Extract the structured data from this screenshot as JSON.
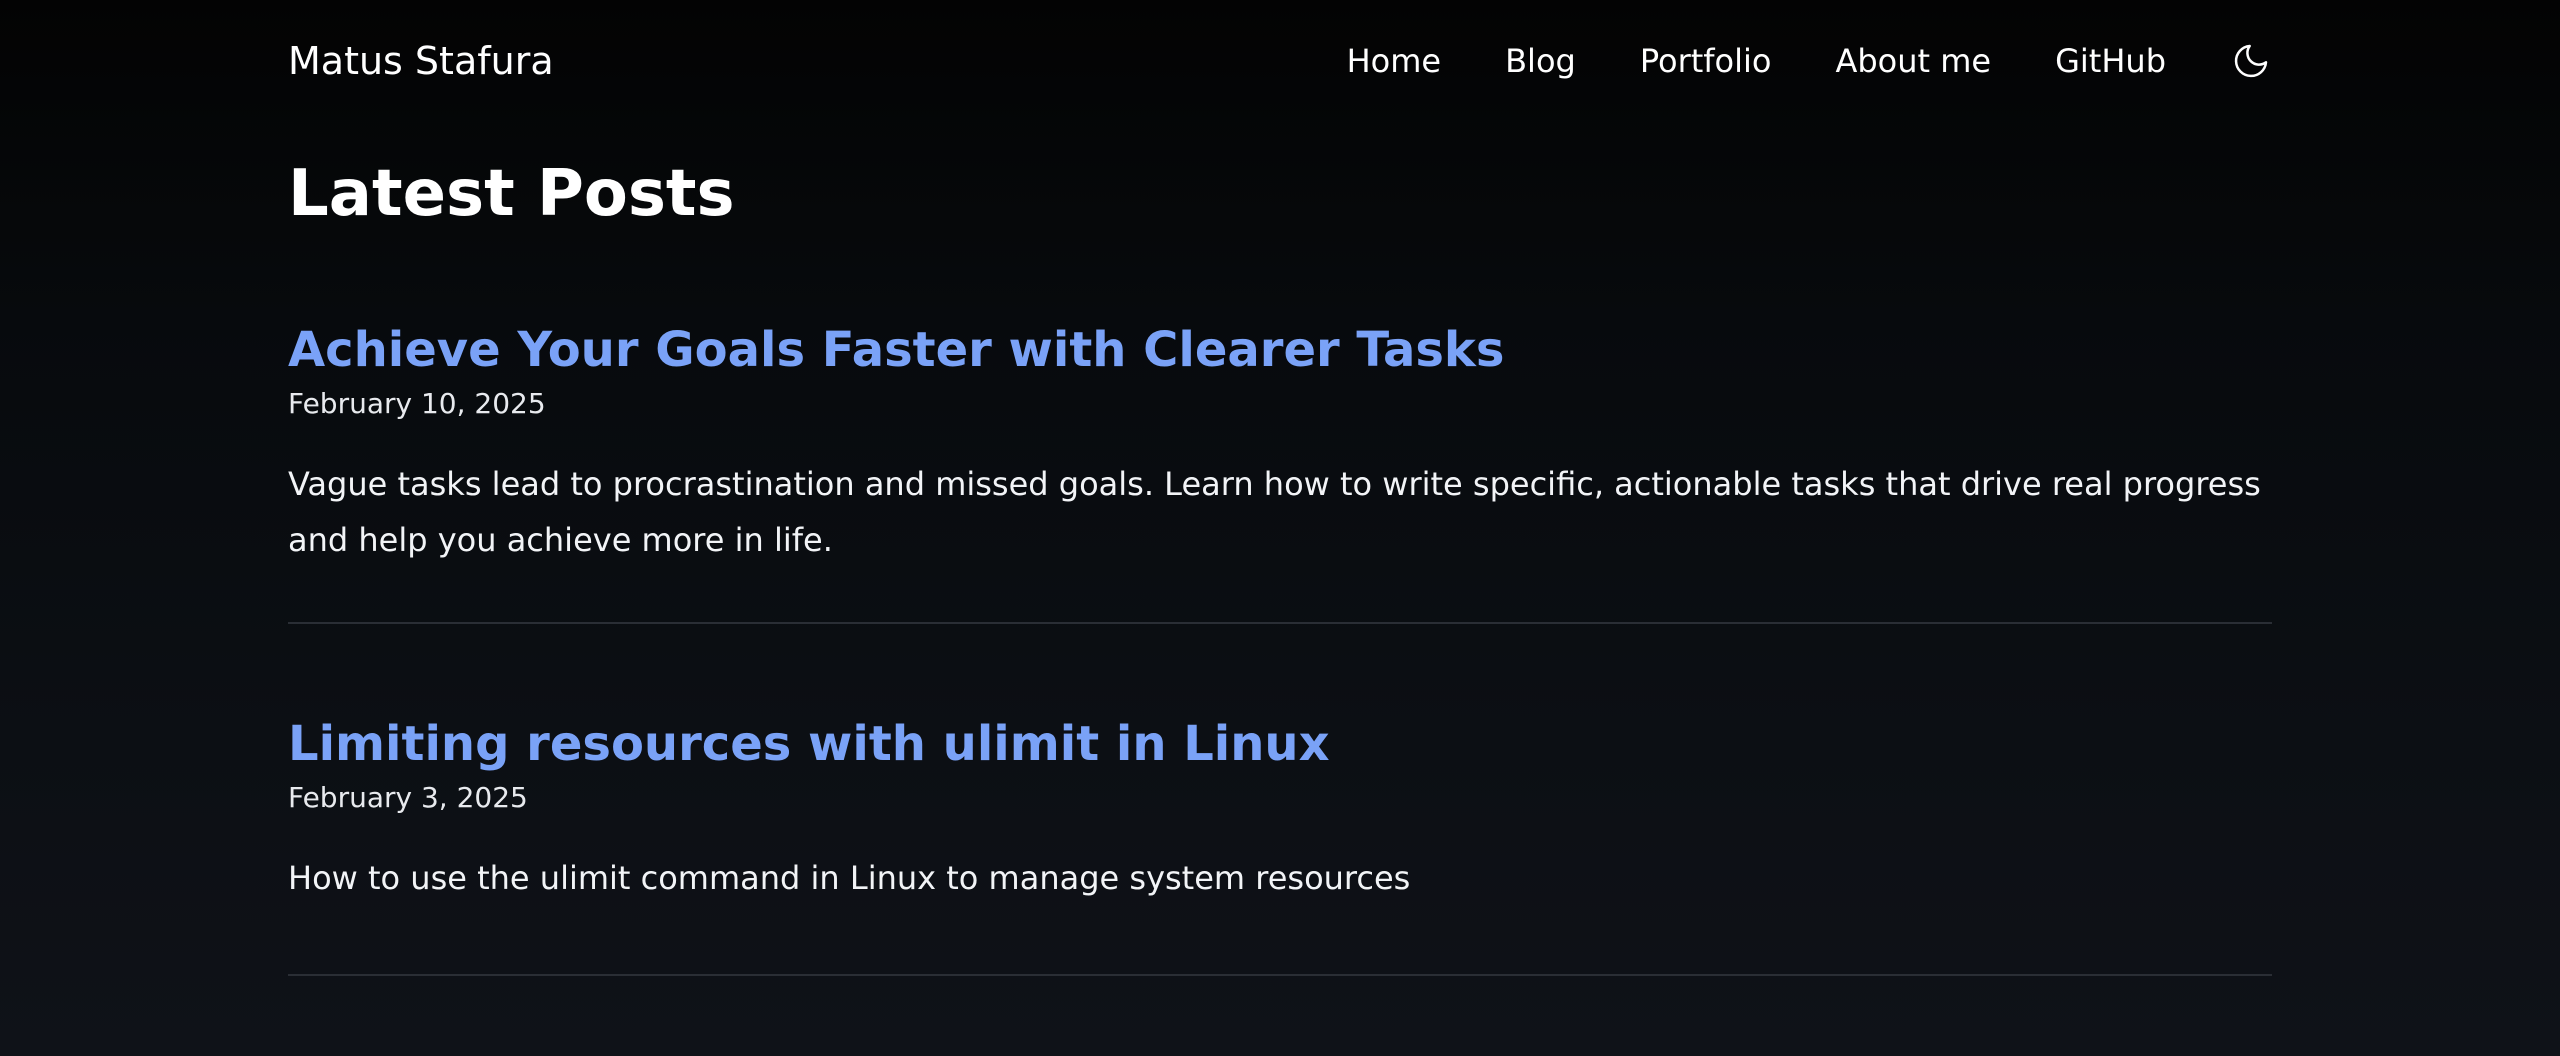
{
  "header": {
    "brand": "Matus Stafura",
    "nav": [
      "Home",
      "Blog",
      "Portfolio",
      "About me",
      "GitHub"
    ],
    "theme_icon": "moon-icon"
  },
  "main": {
    "title": "Latest Posts",
    "posts": [
      {
        "title": "Achieve Your Goals Faster with Clearer Tasks",
        "date": "February 10, 2025",
        "summary": "Vague tasks lead to procrastination and missed goals. Learn how to write specific, actionable tasks that drive real progress and help you achieve more in life."
      },
      {
        "title": "Limiting resources with ulimit in Linux",
        "date": "February 3, 2025",
        "summary": "How to use the ulimit command in Linux to manage system resources"
      }
    ]
  },
  "colors": {
    "background": "#0c0f14",
    "text": "#f2f4f7",
    "link": "#7aa2f7",
    "divider": "#2a2e35"
  }
}
